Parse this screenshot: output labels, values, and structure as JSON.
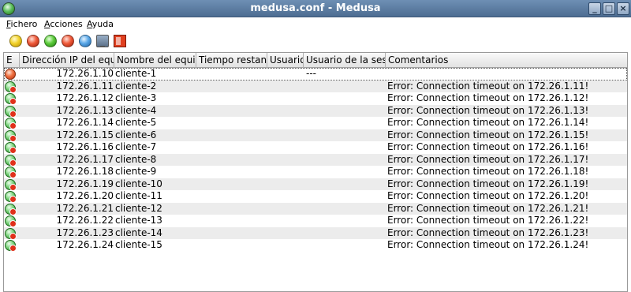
{
  "window": {
    "title": "medusa.conf - Medusa",
    "controls": {
      "minimize": "_",
      "maximize": "□",
      "close": "×"
    }
  },
  "menu": {
    "items": [
      {
        "accel": "F",
        "rest": "ichero"
      },
      {
        "accel": "A",
        "rest": "cciones"
      },
      {
        "accel": "A",
        "rest": "yuda"
      }
    ]
  },
  "toolbar": {
    "buttons": [
      "yellow-ball-icon",
      "red-ball-icon",
      "green-ball-icon",
      "red-ball-icon",
      "blue-ball-icon",
      "monitor-icon",
      "exit-icon"
    ]
  },
  "table": {
    "headers": [
      "E",
      "Dirección IP del equ",
      "Nombre del equip",
      "Tiempo restan",
      "Usuario",
      "Usuario de la ses",
      "Comentarios"
    ],
    "rows": [
      {
        "status": "off",
        "ip": "172.26.1.10",
        "name": "cliente-1",
        "time": "",
        "user": "",
        "session": "---",
        "comment": ""
      },
      {
        "status": "error",
        "ip": "172.26.1.11",
        "name": "cliente-2",
        "time": "",
        "user": "",
        "session": "",
        "comment": "Error: Connection timeout on 172.26.1.11!"
      },
      {
        "status": "error",
        "ip": "172.26.1.12",
        "name": "cliente-3",
        "time": "",
        "user": "",
        "session": "",
        "comment": "Error: Connection timeout on 172.26.1.12!"
      },
      {
        "status": "error",
        "ip": "172.26.1.13",
        "name": "cliente-4",
        "time": "",
        "user": "",
        "session": "",
        "comment": "Error: Connection timeout on 172.26.1.13!"
      },
      {
        "status": "error",
        "ip": "172.26.1.14",
        "name": "cliente-5",
        "time": "",
        "user": "",
        "session": "",
        "comment": "Error: Connection timeout on 172.26.1.14!"
      },
      {
        "status": "error",
        "ip": "172.26.1.15",
        "name": "cliente-6",
        "time": "",
        "user": "",
        "session": "",
        "comment": "Error: Connection timeout on 172.26.1.15!"
      },
      {
        "status": "error",
        "ip": "172.26.1.16",
        "name": "cliente-7",
        "time": "",
        "user": "",
        "session": "",
        "comment": "Error: Connection timeout on 172.26.1.16!"
      },
      {
        "status": "error",
        "ip": "172.26.1.17",
        "name": "cliente-8",
        "time": "",
        "user": "",
        "session": "",
        "comment": "Error: Connection timeout on 172.26.1.17!"
      },
      {
        "status": "error",
        "ip": "172.26.1.18",
        "name": "cliente-9",
        "time": "",
        "user": "",
        "session": "",
        "comment": "Error: Connection timeout on 172.26.1.18!"
      },
      {
        "status": "error",
        "ip": "172.26.1.19",
        "name": "cliente-10",
        "time": "",
        "user": "",
        "session": "",
        "comment": "Error: Connection timeout on 172.26.1.19!"
      },
      {
        "status": "error",
        "ip": "172.26.1.20",
        "name": "cliente-11",
        "time": "",
        "user": "",
        "session": "",
        "comment": "Error: Connection timeout on 172.26.1.20!"
      },
      {
        "status": "error",
        "ip": "172.26.1.21",
        "name": "cliente-12",
        "time": "",
        "user": "",
        "session": "",
        "comment": "Error: Connection timeout on 172.26.1.21!"
      },
      {
        "status": "error",
        "ip": "172.26.1.22",
        "name": "cliente-13",
        "time": "",
        "user": "",
        "session": "",
        "comment": "Error: Connection timeout on 172.26.1.22!"
      },
      {
        "status": "error",
        "ip": "172.26.1.23",
        "name": "cliente-14",
        "time": "",
        "user": "",
        "session": "",
        "comment": "Error: Connection timeout on 172.26.1.23!"
      },
      {
        "status": "error",
        "ip": "172.26.1.24",
        "name": "cliente-15",
        "time": "",
        "user": "",
        "session": "",
        "comment": "Error: Connection timeout on 172.26.1.24!"
      }
    ]
  }
}
